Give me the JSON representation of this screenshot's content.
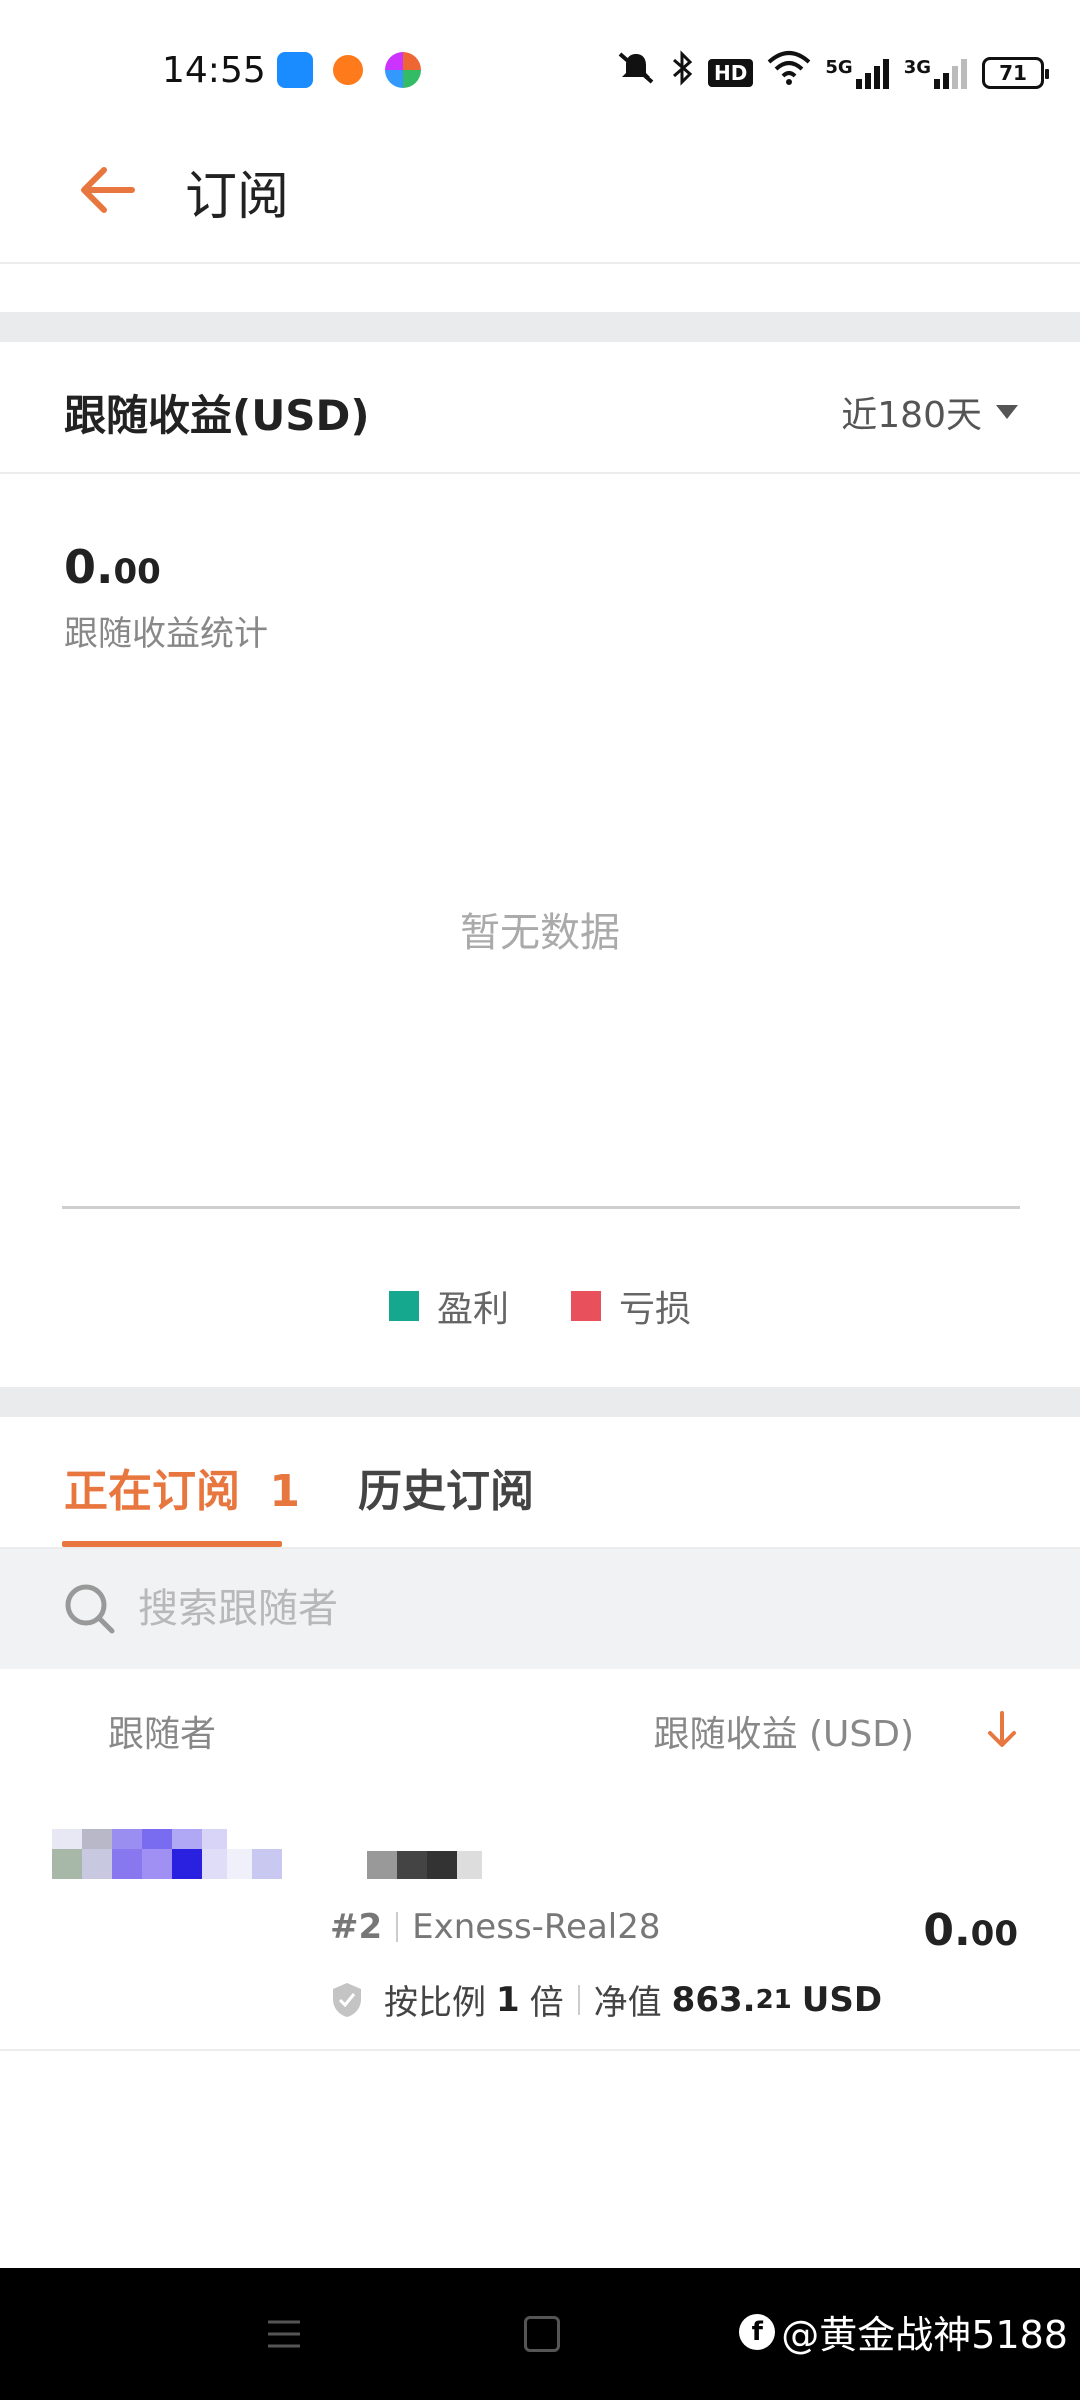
{
  "status_bar": {
    "time": "14:55",
    "network_5g": "5G",
    "network_3g": "3G",
    "hd_label": "HD",
    "battery": "71"
  },
  "header": {
    "title": "订阅"
  },
  "earnings_card": {
    "title": "跟随收益(USD)",
    "range_label": "近180天",
    "value_int": "0.",
    "value_dec": "00",
    "stat_label": "跟随收益统计",
    "no_data": "暂无数据",
    "legend_profit": "盈利",
    "legend_loss": "亏损",
    "colors": {
      "profit": "#16a88e",
      "loss": "#e8505b",
      "accent": "#e8773f"
    }
  },
  "tabs": {
    "active_label": "正在订阅",
    "active_count": "1",
    "history_label": "历史订阅"
  },
  "search": {
    "placeholder": "搜索跟随者"
  },
  "list": {
    "col_follower": "跟随者",
    "col_earnings": "跟随收益 (USD)",
    "rows": [
      {
        "rank": "#2",
        "account": "Exness-Real28",
        "value_int": "0.",
        "value_dec": "00",
        "mode_prefix": "按比例",
        "multiplier": "1",
        "mode_suffix": "倍",
        "equity_label": "净值",
        "equity_int": "863.",
        "equity_dec": "21",
        "currency": "USD"
      }
    ]
  },
  "watermark": {
    "text": "@黄金战神5188"
  }
}
